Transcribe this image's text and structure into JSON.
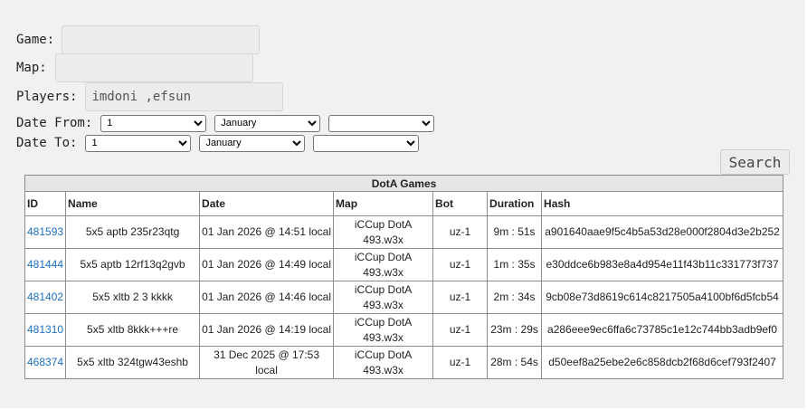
{
  "search": {
    "game_label": "Game:",
    "game_value": "",
    "map_label": "Map:",
    "map_value": "",
    "players_label": "Players:",
    "players_value": "imdoni ,efsun",
    "date_from_label": "Date From:",
    "date_to_label": "Date To:",
    "date_from": {
      "day": "1",
      "month": "January",
      "year": ""
    },
    "date_to": {
      "day": "1",
      "month": "January",
      "year": ""
    },
    "search_button": "Search"
  },
  "table": {
    "caption": "DotA Games",
    "columns": [
      "ID",
      "Name",
      "Date",
      "Map",
      "Bot",
      "Duration",
      "Hash"
    ],
    "rows": [
      {
        "id": "481593",
        "name": "5x5 aptb 235r23qtg",
        "date": "01 Jan 2026 @ 14:51 local",
        "map": "iCCup DotA 493.w3x",
        "bot": "uz-1",
        "duration": "9m : 51s",
        "hash": "a901640aae9f5c4b5a53d28e000f2804d3e2b252"
      },
      {
        "id": "481444",
        "name": "5x5 aptb 12rf13q2gvb",
        "date": "01 Jan 2026 @ 14:49 local",
        "map": "iCCup DotA 493.w3x",
        "bot": "uz-1",
        "duration": "1m : 35s",
        "hash": "e30ddce6b983e8a4d954e11f43b11c331773f737"
      },
      {
        "id": "481402",
        "name": "5x5 xltb 2 3 kkkk",
        "date": "01 Jan 2026 @ 14:46 local",
        "map": "iCCup DotA 493.w3x",
        "bot": "uz-1",
        "duration": "2m : 34s",
        "hash": "9cb08e73d8619c614c8217505a4100bf6d5fcb54"
      },
      {
        "id": "481310",
        "name": "5x5 xltb 8kkk+++re",
        "date": "01 Jan 2026 @ 14:19 local",
        "map": "iCCup DotA 493.w3x",
        "bot": "uz-1",
        "duration": "23m : 29s",
        "hash": "a286eee9ec6ffa6c73785c1e12c744bb3adb9ef0"
      },
      {
        "id": "468374",
        "name": "5x5 xltb 324tgw43eshb",
        "date": "31 Dec 2025 @ 17:53 local",
        "map": "iCCup DotA 493.w3x",
        "bot": "uz-1",
        "duration": "28m : 54s",
        "hash": "d50eef8a25ebe2e6c858dcb2f68d6cef793f2407"
      }
    ]
  },
  "colors": {
    "link": "#1a6fc4",
    "page_bg": "#f1f1f1",
    "input_bg": "#ececec"
  }
}
